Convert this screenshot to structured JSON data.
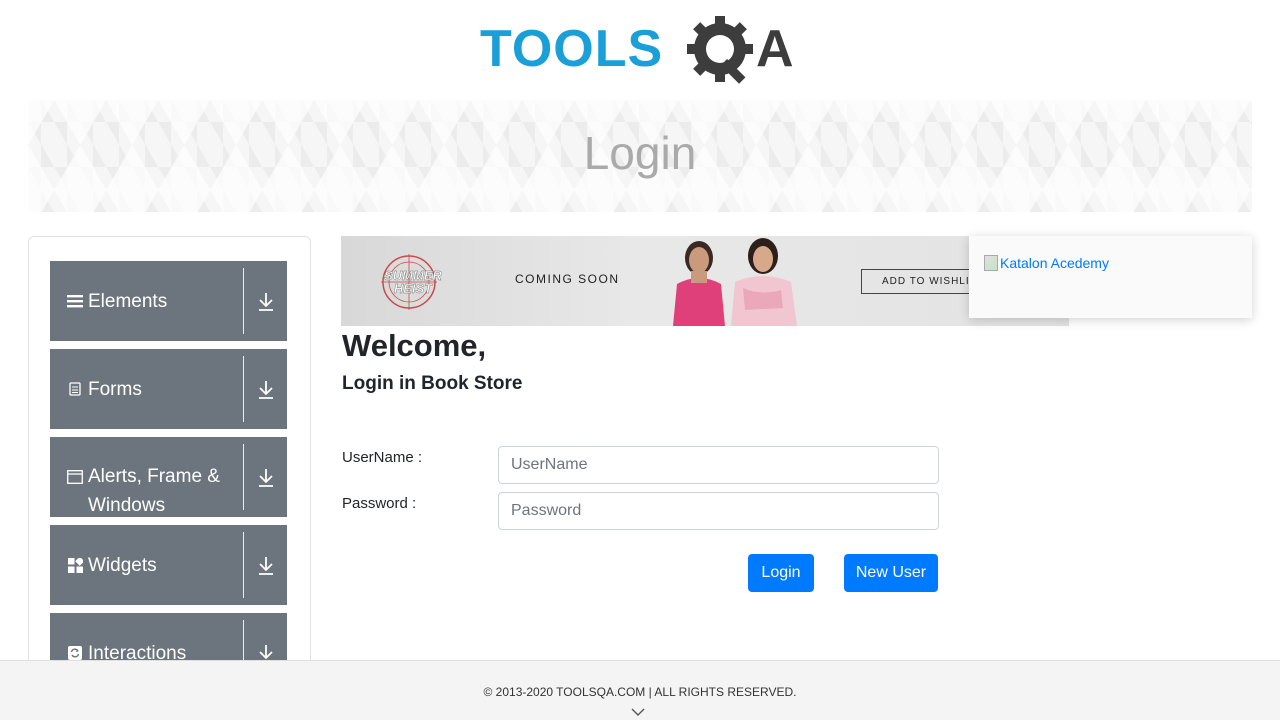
{
  "header": {
    "logo_text": "TOOLSQA",
    "logo_icon": "gear-magnifier-icon",
    "brand_colors": {
      "tools": "#1a9fd8",
      "qa": "#3d3d3d"
    }
  },
  "banner": {
    "title": "Login"
  },
  "sidebar": {
    "groups": [
      {
        "label": "Elements",
        "icon": "hamburger-icon"
      },
      {
        "label": "Forms",
        "icon": "document-icon"
      },
      {
        "label": "Alerts, Frame & Windows",
        "icon": "window-icon"
      },
      {
        "label": "Widgets",
        "icon": "widgets-icon"
      },
      {
        "label": "Interactions",
        "icon": "refresh-icon"
      }
    ],
    "group_bg": "#6c757d"
  },
  "ad": {
    "badge_line1": "SUMMER",
    "badge_line2": "HEIST",
    "coming_soon": "COMING SOON",
    "wishlist": "ADD TO WISHLIST"
  },
  "side_ad": {
    "link_text": "Katalon Acedemy"
  },
  "main": {
    "welcome": "Welcome,",
    "subtitle": "Login in Book Store",
    "username_label": "UserName :",
    "username_placeholder": "UserName",
    "password_label": "Password :",
    "password_placeholder": "Password",
    "login_button": "Login",
    "new_user_button": "New User",
    "accent": "#007bff"
  },
  "footer": {
    "text": "© 2013-2020 TOOLSQA.COM | ALL RIGHTS RESERVED."
  }
}
